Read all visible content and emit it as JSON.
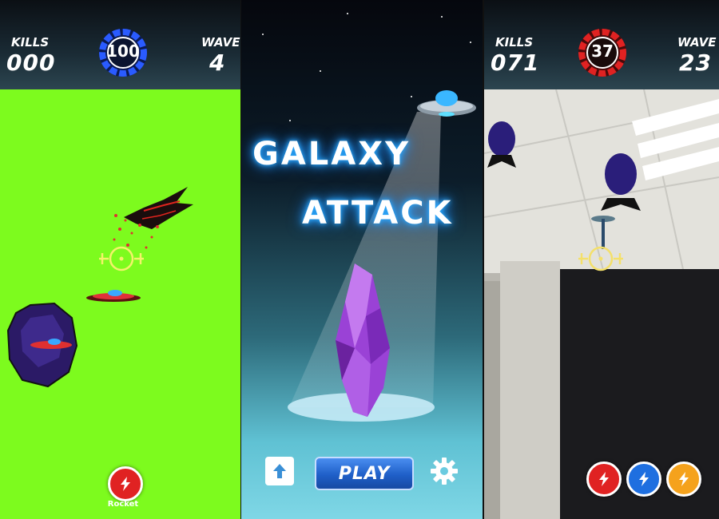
{
  "screen_left": {
    "kills_label": "KILLS",
    "kills_value": "000",
    "wave_label": "WAVE",
    "wave_value": "4",
    "gauge_value": "100",
    "gauge_color": "#2a5bff",
    "background_color": "#7dfb1e",
    "power_button_label": "Rocket",
    "power_button_color": "#e02222"
  },
  "screen_middle": {
    "title_line1": "GALAXY",
    "title_line2": "ATTACK",
    "play_label": "PLAY",
    "upgrade_icon": "arrow-up-icon",
    "settings_icon": "gear-icon"
  },
  "screen_right": {
    "kills_label": "KILLS",
    "kills_value": "071",
    "wave_label": "WAVE",
    "wave_value": "23",
    "gauge_value": "37",
    "gauge_color": "#e02222",
    "power_buttons": [
      {
        "icon": "lightning-icon",
        "color": "#e02222"
      },
      {
        "icon": "lightning-icon",
        "color": "#1e6fe0"
      },
      {
        "icon": "lightning-icon",
        "color": "#f5a21c"
      }
    ]
  }
}
